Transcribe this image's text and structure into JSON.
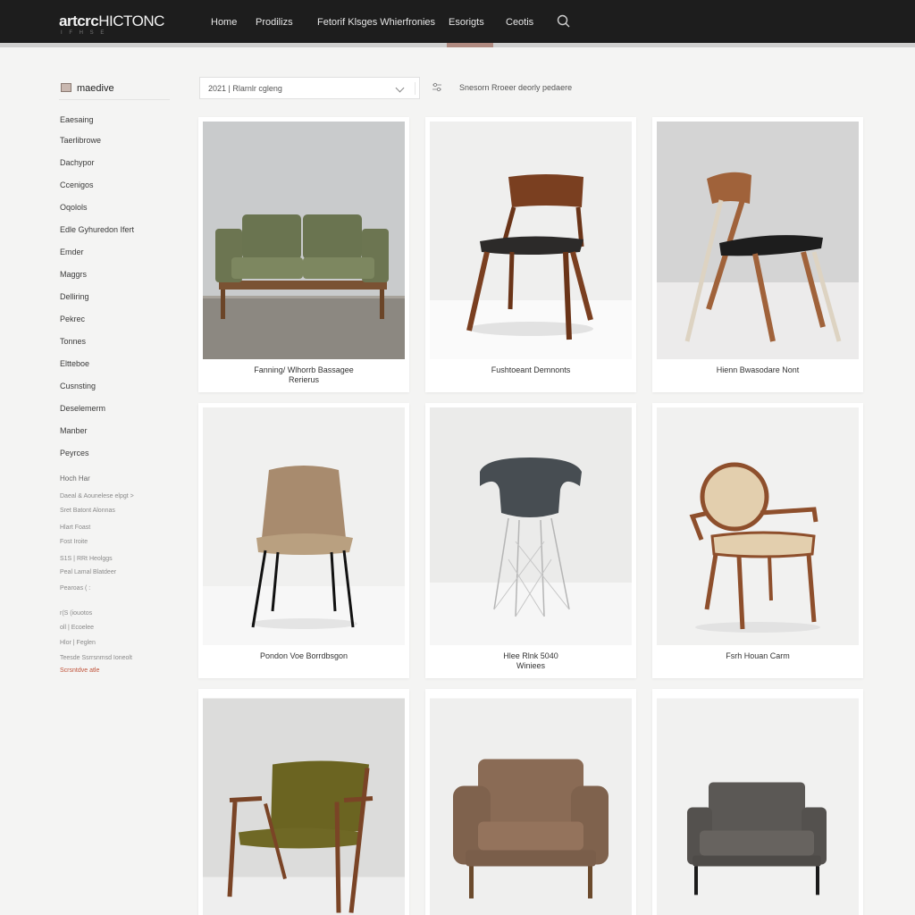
{
  "header": {
    "brand_bold": "artcrc",
    "brand_rest": "HICTONC",
    "brand_tagline": "I  F  H  S  E",
    "nav": [
      "Home",
      "Prodilizs",
      "Fetorif Klsges  Whierfronies",
      "Esorigts",
      "Ceotis"
    ]
  },
  "sidebar": {
    "heading": "maedive",
    "categories": [
      "Eaesaing",
      "Taerlibrowe",
      "Dachypor",
      "Ccenigos",
      "Oqolols",
      "Edle Gyhuredon Ifert",
      "Emder",
      "Maggrs",
      "Delliring",
      "Pekrec",
      "Tonnes",
      "Eltteboe",
      "Cusnsting",
      "Deselemerm",
      "Manber",
      "Peyrces"
    ],
    "filters_heading": "Hoch Har",
    "filters": [
      "Daeal & Aounelese elpgt  >",
      "Sret  Batont Alonnas",
      "Hlart  Foast",
      "Fost  Iroite",
      "S1S  |  RRt  Heolggs",
      "Peal  Lamal  Blatdeer",
      "Pearoas  ( :",
      "r(S  (iouotos",
      "oll  |  Ecoelee",
      "Hlor  |  Feglen",
      "Teesde  Ssrrsnmsd Ioneolt"
    ],
    "clear_link": "Scrsntdve  atle"
  },
  "toolbar": {
    "sort_value": "2021 | Rlarnlr  cgleng",
    "result_text": "Snesorn  Rroeer  deorly  pedaere"
  },
  "products": [
    {
      "title": "Fanning/ Wlhorrb Bassagee\nRerierus",
      "image": "green-loveseat"
    },
    {
      "title": "Fushtoeant  Demnonts",
      "image": "walnut-dining-chair"
    },
    {
      "title": "Hienn  Bwasodare  Nont",
      "image": "slanted-wood-chair"
    },
    {
      "title": "Pondon  Voe  Borrdbsgon",
      "image": "upholstered-side-chair"
    },
    {
      "title": "Hlee  Rlnk  5040\nWiniees",
      "image": "shell-chair"
    },
    {
      "title": "Fsrh Houan  Carm",
      "image": "medallion-armchair"
    },
    {
      "title": "",
      "image": "olive-lounge-chair"
    },
    {
      "title": "",
      "image": "brown-club-chair"
    },
    {
      "title": "",
      "image": "grey-armchair"
    }
  ]
}
